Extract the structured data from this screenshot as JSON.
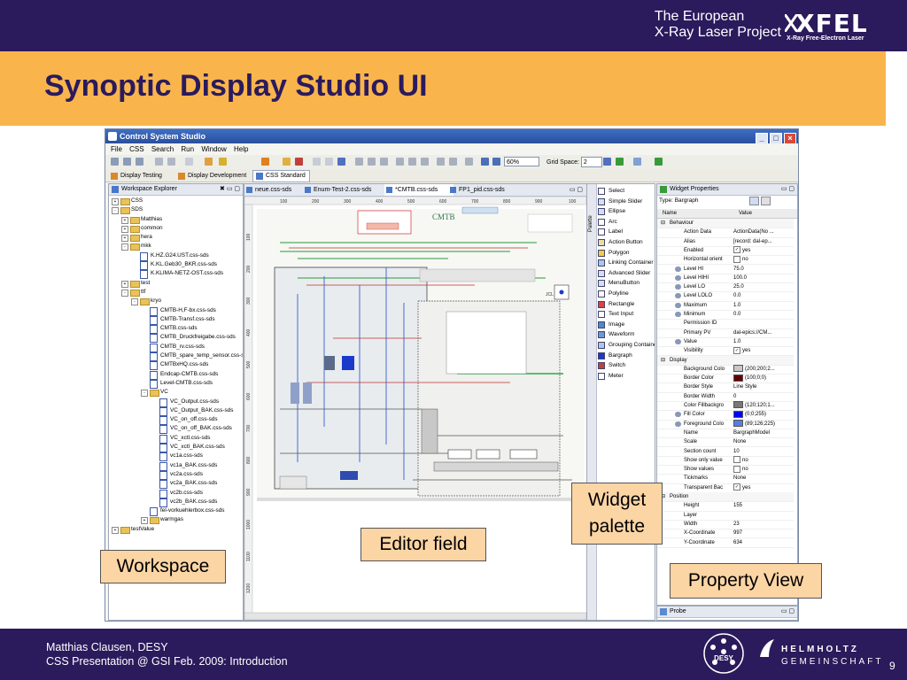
{
  "header": {
    "org_line1": "The European",
    "org_line2": "X-Ray Laser Project",
    "logo_text": "XFEL",
    "logo_sub": "X-Ray Free-Electron Laser"
  },
  "slide": {
    "title": "Synoptic Display Studio UI",
    "page_number": "9"
  },
  "footer": {
    "author": "Matthias Clausen, DESY",
    "event": "CSS Presentation @ GSI Feb. 2009: Introduction",
    "desy_logo": "DESY",
    "helmholtz_line1": "HELMHOLTZ",
    "helmholtz_line2": "GEMEINSCHAFT"
  },
  "callouts": {
    "workspace": "Workspace",
    "editor": "Editor field",
    "palette_line1": "Widget",
    "palette_line2": "palette",
    "property": "Property View"
  },
  "window": {
    "title": "Control System Studio",
    "menu": [
      "File",
      "CSS",
      "Search",
      "Run",
      "Window",
      "Help"
    ],
    "zoom": "60%",
    "grid_label": "Grid Space:",
    "grid_value": "2",
    "perspectives": [
      "Display Testing",
      "Display Development",
      "CSS Standard"
    ]
  },
  "workspace": {
    "tab": "Workspace Explorer",
    "tree": [
      {
        "label": "CSS",
        "depth": 0,
        "kind": "folder",
        "toggle": "+"
      },
      {
        "label": "SDS",
        "depth": 0,
        "kind": "folder",
        "toggle": "-"
      },
      {
        "label": "Matthias",
        "depth": 1,
        "kind": "folder",
        "toggle": "+"
      },
      {
        "label": "common",
        "depth": 1,
        "kind": "folder",
        "toggle": "+"
      },
      {
        "label": "hera",
        "depth": 1,
        "kind": "folder",
        "toggle": "+"
      },
      {
        "label": "mkk",
        "depth": 1,
        "kind": "folder",
        "toggle": "-"
      },
      {
        "label": "K.HZ.G24.UST.css-sds",
        "depth": 2,
        "kind": "file",
        "toggle": ""
      },
      {
        "label": "K.KL.Geb30_BKR.css-sds",
        "depth": 2,
        "kind": "file",
        "toggle": ""
      },
      {
        "label": "K.KLIMA-NETZ-OST.css-sds",
        "depth": 2,
        "kind": "file",
        "toggle": ""
      },
      {
        "label": "test",
        "depth": 1,
        "kind": "folder",
        "toggle": "+"
      },
      {
        "label": "ttf",
        "depth": 1,
        "kind": "folder",
        "toggle": "-"
      },
      {
        "label": "kryo",
        "depth": 2,
        "kind": "folder",
        "toggle": "-"
      },
      {
        "label": "CMTB-H,F-bx.css-sds",
        "depth": 3,
        "kind": "file",
        "toggle": ""
      },
      {
        "label": "CMTB-Transf.css-sds",
        "depth": 3,
        "kind": "file",
        "toggle": ""
      },
      {
        "label": "CMTB.css-sds",
        "depth": 3,
        "kind": "file",
        "toggle": ""
      },
      {
        "label": "CMTB_Druckfreigabe.css-sds",
        "depth": 3,
        "kind": "file",
        "toggle": ""
      },
      {
        "label": "CMTB_rv.css-sds",
        "depth": 3,
        "kind": "file",
        "toggle": ""
      },
      {
        "label": "CMTB_spare_temp_sensor.css-sds",
        "depth": 3,
        "kind": "file",
        "toggle": ""
      },
      {
        "label": "CMTBxHQ.css-sds",
        "depth": 3,
        "kind": "file",
        "toggle": ""
      },
      {
        "label": "Endcap-CMTB.css-sds",
        "depth": 3,
        "kind": "file",
        "toggle": ""
      },
      {
        "label": "Level-CMTB.css-sds",
        "depth": 3,
        "kind": "file",
        "toggle": ""
      },
      {
        "label": "VC",
        "depth": 3,
        "kind": "folder",
        "toggle": "-"
      },
      {
        "label": "VC_Output.css-sds",
        "depth": 4,
        "kind": "file",
        "toggle": ""
      },
      {
        "label": "VC_Output_BAK.css-sds",
        "depth": 4,
        "kind": "file",
        "toggle": ""
      },
      {
        "label": "VC_on_off.css-sds",
        "depth": 4,
        "kind": "file",
        "toggle": ""
      },
      {
        "label": "VC_on_off_BAK.css-sds",
        "depth": 4,
        "kind": "file",
        "toggle": ""
      },
      {
        "label": "VC_xctl.css-sds",
        "depth": 4,
        "kind": "file",
        "toggle": ""
      },
      {
        "label": "VC_xctl_BAK.css-sds",
        "depth": 4,
        "kind": "file",
        "toggle": ""
      },
      {
        "label": "vc1a.css-sds",
        "depth": 4,
        "kind": "file",
        "toggle": ""
      },
      {
        "label": "vc1a_BAK.css-sds",
        "depth": 4,
        "kind": "file",
        "toggle": ""
      },
      {
        "label": "vc2a.css-sds",
        "depth": 4,
        "kind": "file",
        "toggle": ""
      },
      {
        "label": "vc2a_BAK.css-sds",
        "depth": 4,
        "kind": "file",
        "toggle": ""
      },
      {
        "label": "vc2b.css-sds",
        "depth": 4,
        "kind": "file",
        "toggle": ""
      },
      {
        "label": "vc2b_BAK.css-sds",
        "depth": 4,
        "kind": "file",
        "toggle": ""
      },
      {
        "label": "fel-vorkuehlerbox.css-sds",
        "depth": 3,
        "kind": "file",
        "toggle": ""
      },
      {
        "label": "warmgas",
        "depth": 3,
        "kind": "folder",
        "toggle": "+"
      },
      {
        "label": "testValue",
        "depth": 0,
        "kind": "folder",
        "toggle": "+"
      }
    ]
  },
  "editor": {
    "tabs": [
      "neue.css-sds",
      "Enum-Test-2.css-sds",
      "*CMTB.css-sds",
      "FP1_pid.css-sds"
    ],
    "ruler_top": [
      "100",
      "200",
      "300",
      "400",
      "500",
      "600",
      "700",
      "800",
      "900",
      "100"
    ],
    "ruler_left": [
      "100",
      "200",
      "300",
      "400",
      "500",
      "600",
      "700",
      "800",
      "900",
      "1000",
      "1100",
      "1200"
    ],
    "canvas_title": "CMTB",
    "palette_label": "Palette"
  },
  "palette": {
    "items": [
      "Select",
      "Simple Slider",
      "Ellipse",
      "Arc",
      "Label",
      "Action Button",
      "Polygon",
      "Linking Container",
      "Advanced Slider",
      "MenuButton",
      "Polyline",
      "Rectangle",
      "Text Input",
      "Image",
      "Waveform",
      "Grouping Container",
      "Bargraph",
      "Switch",
      "Meter"
    ]
  },
  "properties": {
    "tab": "Widget Properties",
    "type_label": "Type: Bargraph",
    "col_name": "Name",
    "col_value": "Value",
    "rows": [
      {
        "k": "Behaviour",
        "v": "",
        "cat": true
      },
      {
        "k": "Action Data",
        "v": "ActionData(No ..."
      },
      {
        "k": "Alias",
        "v": "[record: dal-ep..."
      },
      {
        "k": "Enabled",
        "v": "yes",
        "cb": "✓"
      },
      {
        "k": "Horizontal orient",
        "v": "no",
        "cb": " "
      },
      {
        "k": "Level HI",
        "v": "75.0",
        "dyn": true
      },
      {
        "k": "Level HIHI",
        "v": "100.0",
        "dyn": true
      },
      {
        "k": "Level LO",
        "v": "25.0",
        "dyn": true
      },
      {
        "k": "Level LOLO",
        "v": "0.0",
        "dyn": true
      },
      {
        "k": "Maximum",
        "v": "1.0",
        "dyn": true
      },
      {
        "k": "Minimum",
        "v": "0.0",
        "dyn": true
      },
      {
        "k": "Permission ID",
        "v": ""
      },
      {
        "k": "Primary PV",
        "v": "dal-epics://CM..."
      },
      {
        "k": "Value",
        "v": "1.0",
        "dyn": true
      },
      {
        "k": "Visibility",
        "v": "yes",
        "cb": "✓"
      },
      {
        "k": "Display",
        "v": "",
        "cat": true
      },
      {
        "k": "Background Colo",
        "v": "(200;200;2...",
        "sw": "#c8c8c8"
      },
      {
        "k": "Border Color",
        "v": "(100;0;0)",
        "sw": "#640000"
      },
      {
        "k": "Border Style",
        "v": "Line Style"
      },
      {
        "k": "Border Width",
        "v": "0"
      },
      {
        "k": "Color Fillbackgro",
        "v": "(120;120;1...",
        "sw": "#787878"
      },
      {
        "k": "Fill Color",
        "v": "(0;0;255)",
        "sw": "#0000ff",
        "dyn": true
      },
      {
        "k": "Foreground Colo",
        "v": "(89;126;225)",
        "sw": "#597ee1",
        "dyn": true
      },
      {
        "k": "Name",
        "v": "BargraphModel"
      },
      {
        "k": "Scale",
        "v": "None"
      },
      {
        "k": "Section count",
        "v": "10"
      },
      {
        "k": "Show only value",
        "v": "no",
        "cb": " "
      },
      {
        "k": "Show values",
        "v": "no",
        "cb": " "
      },
      {
        "k": "Tickmarks",
        "v": "None"
      },
      {
        "k": "Transparent Bac",
        "v": "yes",
        "cb": "✓"
      },
      {
        "k": "Position",
        "v": "",
        "cat": true
      },
      {
        "k": "Height",
        "v": "155"
      },
      {
        "k": "Layer",
        "v": ""
      },
      {
        "k": "Width",
        "v": "23"
      },
      {
        "k": "X-Coordinate",
        "v": "997"
      },
      {
        "k": "Y-Coordinate",
        "v": "634"
      }
    ],
    "probe_tab": "Probe"
  }
}
